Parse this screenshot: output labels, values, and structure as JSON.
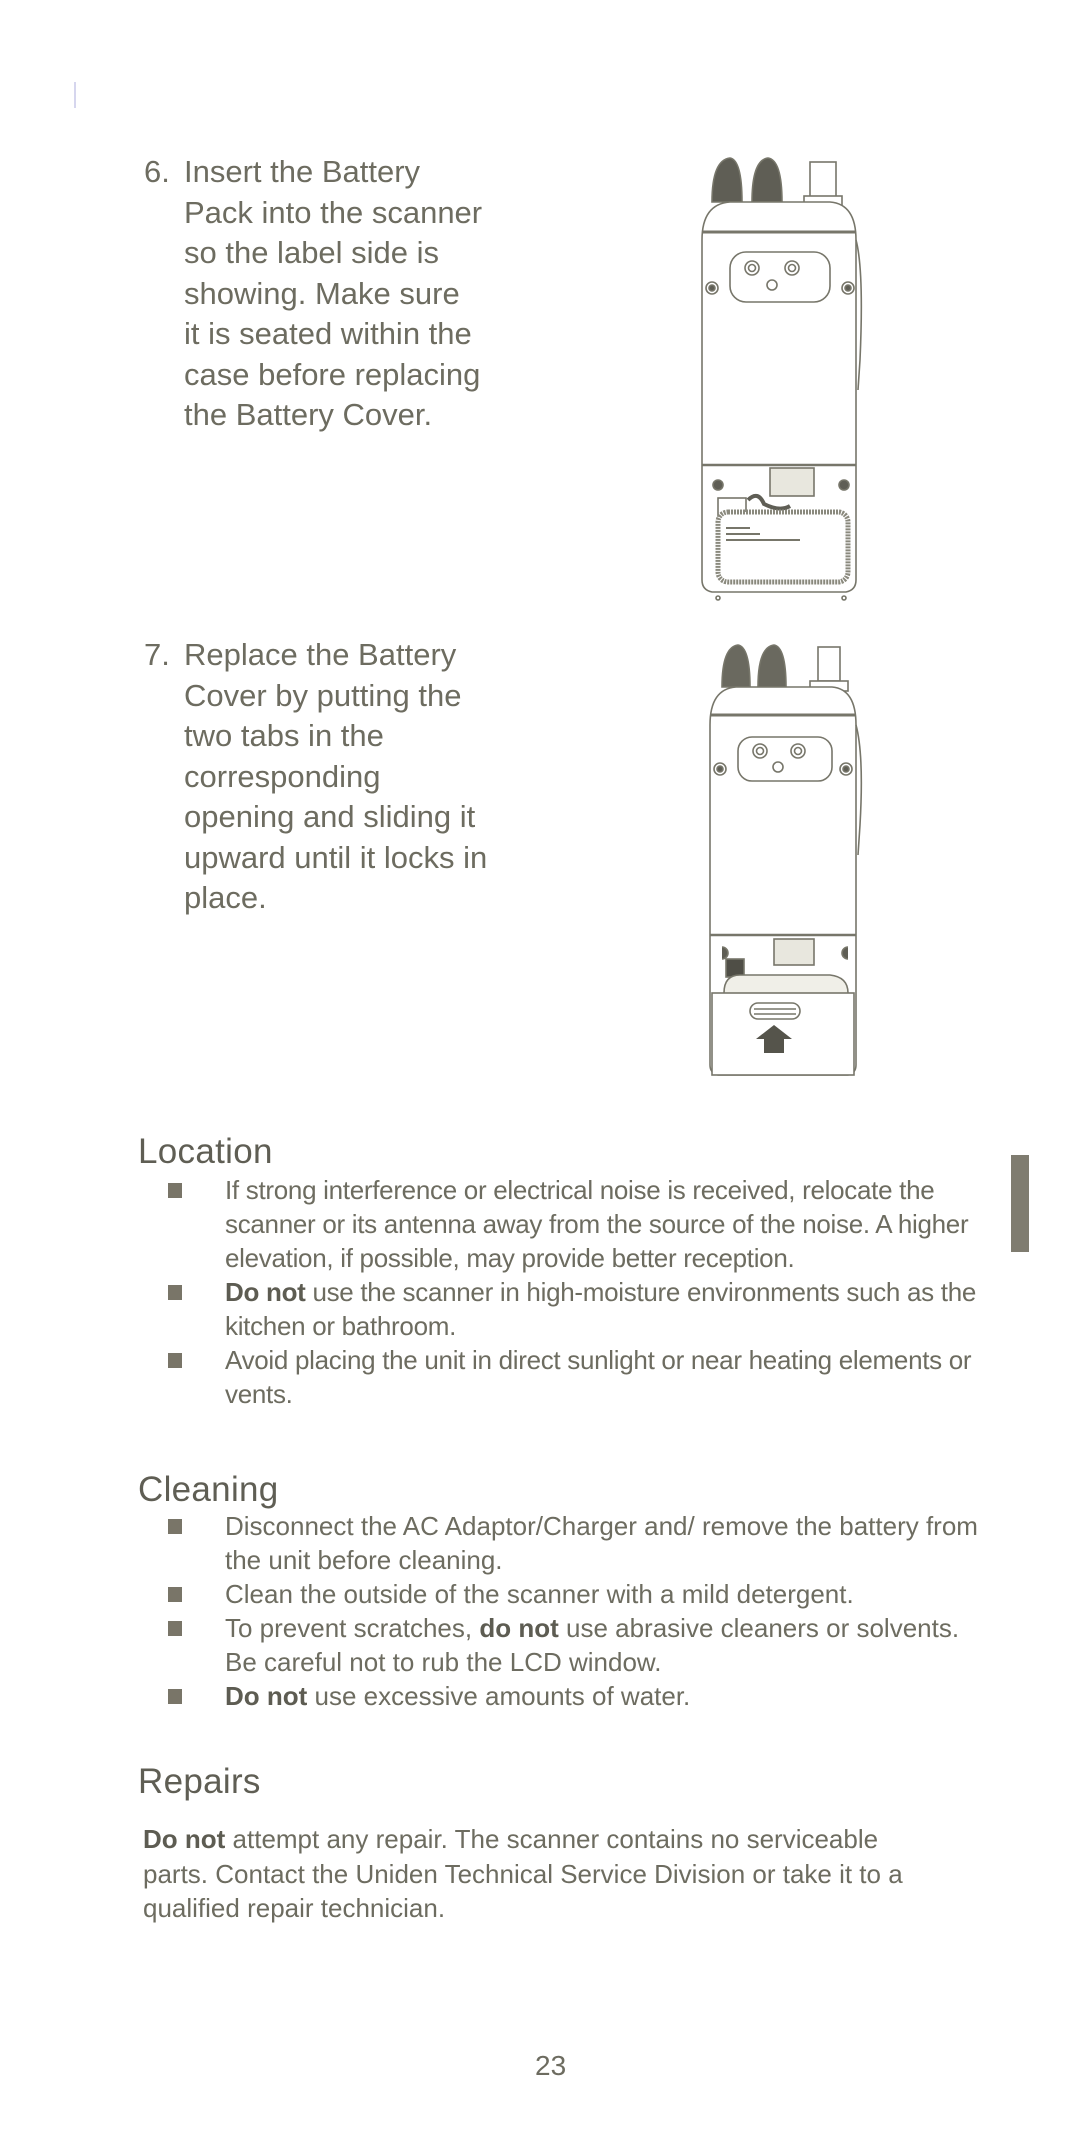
{
  "steps": [
    {
      "number": "6.",
      "text": "Insert the Battery\nPack into the scanner\nso the label side is\nshowing.  Make sure\nit is seated within the\ncase before replacing\nthe Battery Cover.",
      "illustration": "scanner-back-battery-pack-inserted"
    },
    {
      "number": "7.",
      "text": "Replace the Battery\nCover by putting the\ntwo tabs in the\ncorresponding\nopening and sliding it\nupward until it locks in\nplace.",
      "illustration": "scanner-back-battery-cover-slide-up"
    }
  ],
  "sections": {
    "location": {
      "heading": "Location",
      "bullets": [
        {
          "bold": "",
          "text": "If strong interference or electrical noise is received, relocate the scanner or its antenna away from the source of the noise.  A higher elevation, if possible, may provide better reception."
        },
        {
          "bold": "Do not",
          "text": " use the scanner in high-moisture environments such as the kitchen or bathroom."
        },
        {
          "bold": "",
          "text": "Avoid placing the unit in direct sunlight or near heating elements or vents."
        }
      ]
    },
    "cleaning": {
      "heading": "Cleaning",
      "bullets": [
        {
          "bold": "",
          "text": "Disconnect the AC Adaptor/Charger and/ remove the battery from the unit before cleaning."
        },
        {
          "bold": "",
          "text": "Clean the outside of the scanner with a mild detergent."
        },
        {
          "bold": "",
          "text_before": "To prevent scratches, ",
          "bold_mid": "do not",
          "text": " use abrasive cleaners or solvents.  Be careful not to rub the LCD window."
        },
        {
          "bold": "Do not",
          "text": " use excessive amounts of water."
        }
      ]
    },
    "repairs": {
      "heading": "Repairs",
      "bold": "Do not",
      "text": " attempt any repair. The scanner contains no serviceable parts. Contact the Uniden Technical Service Division or take it to a qualified repair technician."
    }
  },
  "page_number": "23",
  "colors": {
    "text": "#6d6c60",
    "heading": "#5f5e54",
    "bullet": "#797568",
    "side_tab": "#7f7c70"
  }
}
